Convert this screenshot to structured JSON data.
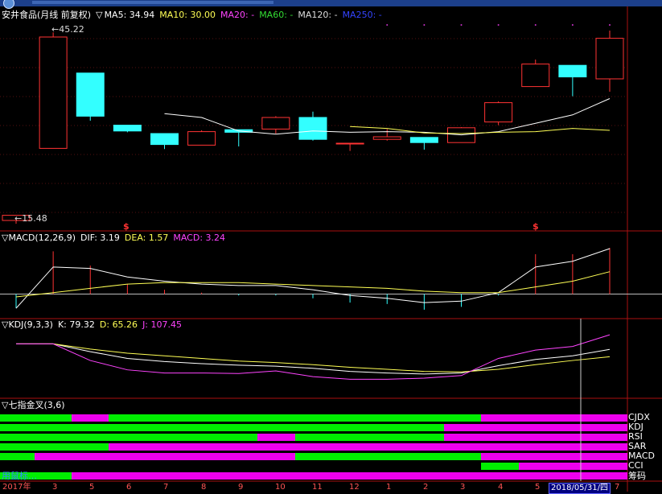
{
  "window": {
    "title_bar_color": "#1c3f8a"
  },
  "price_panel": {
    "stock_name": "安井食品(月线 前复权)",
    "indicator_marker": "▽",
    "ma_items": [
      {
        "text": "MA5: 34.94",
        "color": "#ffffff"
      },
      {
        "text": "MA10: 30.00",
        "color": "#ffff55"
      },
      {
        "text": "MA20: -",
        "color": "#ff44ff"
      },
      {
        "text": "MA60: -",
        "color": "#33dd33"
      },
      {
        "text": "MA120: -",
        "color": "#dddddd"
      },
      {
        "text": "MA250: -",
        "color": "#3344ff"
      }
    ],
    "high_label": "45.22",
    "low_label": "15.48",
    "arrow_glyph": "←",
    "signal_glyph": "$"
  },
  "macd_panel": {
    "name": "▽MACD(12,26,9)",
    "items": [
      {
        "text": "DIF: 3.19",
        "color": "#ffffff"
      },
      {
        "text": "DEA: 1.57",
        "color": "#ffff55"
      },
      {
        "text": "MACD: 3.24",
        "color": "#ff44ff"
      }
    ]
  },
  "kdj_panel": {
    "name": "▽KDJ(9,3,3)",
    "items": [
      {
        "text": "K: 79.32",
        "color": "#ffffff"
      },
      {
        "text": "D: 65.26",
        "color": "#ffff55"
      },
      {
        "text": "J: 107.45",
        "color": "#ff44ff"
      }
    ]
  },
  "seven_panel": {
    "name": "▽七指金叉(3,6)",
    "rows": [
      "CJDX",
      "KDJ",
      "RSI",
      "SAR",
      "MACD",
      "CCI",
      "筹码"
    ],
    "bottom_left_text": "用鼠标…"
  },
  "x_axis": {
    "labels": [
      "2017年",
      "3",
      "5",
      "6",
      "7",
      "8",
      "9",
      "10",
      "11",
      "12",
      "1",
      "2",
      "3",
      "4",
      "5"
    ],
    "cursor_date": "2018/05/31/四",
    "cursor_extra": "7"
  },
  "chart_data": {
    "type": "candlestick",
    "title": "安井食品(月线 前复权)",
    "x": [
      "2017-02",
      "2017-03",
      "2017-04",
      "2017-05",
      "2017-06",
      "2017-07",
      "2017-08",
      "2017-09",
      "2017-10",
      "2017-11",
      "2017-12",
      "2018-01",
      "2018-02",
      "2018-03",
      "2018-04",
      "2018-05",
      "2018-06"
    ],
    "ohlc": [
      {
        "open": 16.0,
        "high": 16.8,
        "low": 15.48,
        "close": 16.8
      },
      {
        "open": 27.2,
        "high": 45.22,
        "low": 27.2,
        "close": 44.5
      },
      {
        "open": 38.9,
        "high": 38.9,
        "low": 31.5,
        "close": 32.2
      },
      {
        "open": 30.8,
        "high": 30.8,
        "low": 29.7,
        "close": 29.9
      },
      {
        "open": 29.5,
        "high": 29.5,
        "low": 27.1,
        "close": 27.8
      },
      {
        "open": 27.7,
        "high": 30.0,
        "low": 27.7,
        "close": 29.8
      },
      {
        "open": 30.1,
        "high": 30.1,
        "low": 27.5,
        "close": 29.7
      },
      {
        "open": 30.2,
        "high": 32.2,
        "low": 29.5,
        "close": 32.0
      },
      {
        "open": 32.0,
        "high": 32.9,
        "low": 28.4,
        "close": 28.6
      },
      {
        "open": 28.0,
        "high": 28.0,
        "low": 26.8,
        "close": 28.0
      },
      {
        "open": 28.6,
        "high": 30.2,
        "low": 28.4,
        "close": 29.0
      },
      {
        "open": 28.9,
        "high": 28.9,
        "low": 27.0,
        "close": 28.1
      },
      {
        "open": 28.1,
        "high": 30.5,
        "low": 28.1,
        "close": 30.4
      },
      {
        "open": 31.3,
        "high": 34.5,
        "low": 30.8,
        "close": 34.3
      },
      {
        "open": 36.8,
        "high": 41.0,
        "low": 36.8,
        "close": 40.3
      },
      {
        "open": 40.1,
        "high": 40.1,
        "low": 35.3,
        "close": 38.3
      },
      {
        "open": 38.0,
        "high": 45.5,
        "low": 36.0,
        "close": 44.3
      }
    ],
    "ma": [
      {
        "name": "MA5",
        "color": "#ffffff",
        "values": [
          null,
          null,
          null,
          null,
          32.6,
          32.0,
          29.9,
          29.4,
          29.9,
          29.7,
          29.8,
          29.7,
          29.3,
          29.8,
          31.1,
          32.4,
          34.94
        ]
      },
      {
        "name": "MA10",
        "color": "#ffff55",
        "values": [
          null,
          null,
          null,
          null,
          null,
          null,
          null,
          null,
          null,
          30.6,
          30.3,
          29.6,
          29.5,
          29.7,
          29.8,
          30.3,
          30.0
        ]
      }
    ],
    "ylim": [
      15.0,
      47.0
    ],
    "signals_x_index": [
      3,
      14
    ],
    "macd": {
      "dif": [
        -1.0,
        1.9,
        1.8,
        1.2,
        0.9,
        0.7,
        0.6,
        0.6,
        0.3,
        -0.1,
        -0.3,
        -0.6,
        -0.5,
        0.1,
        1.9,
        2.3,
        3.19
      ],
      "dea": [
        -0.2,
        0.1,
        0.4,
        0.7,
        0.8,
        0.8,
        0.8,
        0.7,
        0.6,
        0.5,
        0.4,
        0.2,
        0.1,
        0.1,
        0.5,
        0.9,
        1.57
      ],
      "hist": [
        -1.0,
        3.0,
        2.0,
        0.7,
        0.3,
        0.1,
        -0.1,
        -0.1,
        -0.3,
        -0.6,
        -0.7,
        -1.1,
        -0.9,
        -0.1,
        2.8,
        2.8,
        3.24
      ],
      "ylim": [
        -1.5,
        3.7
      ]
    },
    "kdj": {
      "k": [
        90,
        90,
        75,
        62,
        56,
        52,
        49,
        47,
        43,
        37,
        34,
        32,
        34,
        48,
        60,
        67,
        79.32
      ],
      "d": [
        90,
        90,
        80,
        72,
        67,
        62,
        57,
        54,
        50,
        45,
        41,
        37,
        36,
        41,
        50,
        58,
        65.26
      ],
      "j": [
        90,
        90,
        58,
        40,
        34,
        34,
        33,
        38,
        27,
        22,
        22,
        24,
        29,
        62,
        78,
        85,
        107.45
      ],
      "ylim": [
        -10,
        120
      ]
    },
    "seven_signals": {
      "order": [
        "CJDX",
        "KDJ",
        "RSI",
        "SAR",
        "MACD",
        "CCI",
        "筹码"
      ],
      "segments": [
        [
          [
            "green",
            0,
            89
          ],
          [
            "magenta",
            89,
            135
          ],
          [
            "green",
            135,
            598
          ],
          [
            "magenta",
            598,
            780
          ]
        ],
        [
          [
            "green",
            0,
            552
          ],
          [
            "magenta",
            552,
            780
          ]
        ],
        [
          [
            "green",
            0,
            320
          ],
          [
            "magenta",
            320,
            367
          ],
          [
            "green",
            367,
            552
          ],
          [
            "magenta",
            552,
            780
          ]
        ],
        [
          [
            "green",
            0,
            135
          ],
          [
            "magenta",
            135,
            780
          ]
        ],
        [
          [
            "green",
            0,
            43
          ],
          [
            "magenta",
            43,
            367
          ],
          [
            "green",
            367,
            598
          ],
          [
            "magenta",
            598,
            780
          ]
        ],
        [
          [
            "none",
            0,
            598
          ],
          [
            "green",
            598,
            645
          ],
          [
            "magenta",
            645,
            780
          ]
        ],
        [
          [
            "green",
            0,
            89
          ],
          [
            "magenta",
            89,
            780
          ]
        ]
      ]
    }
  }
}
